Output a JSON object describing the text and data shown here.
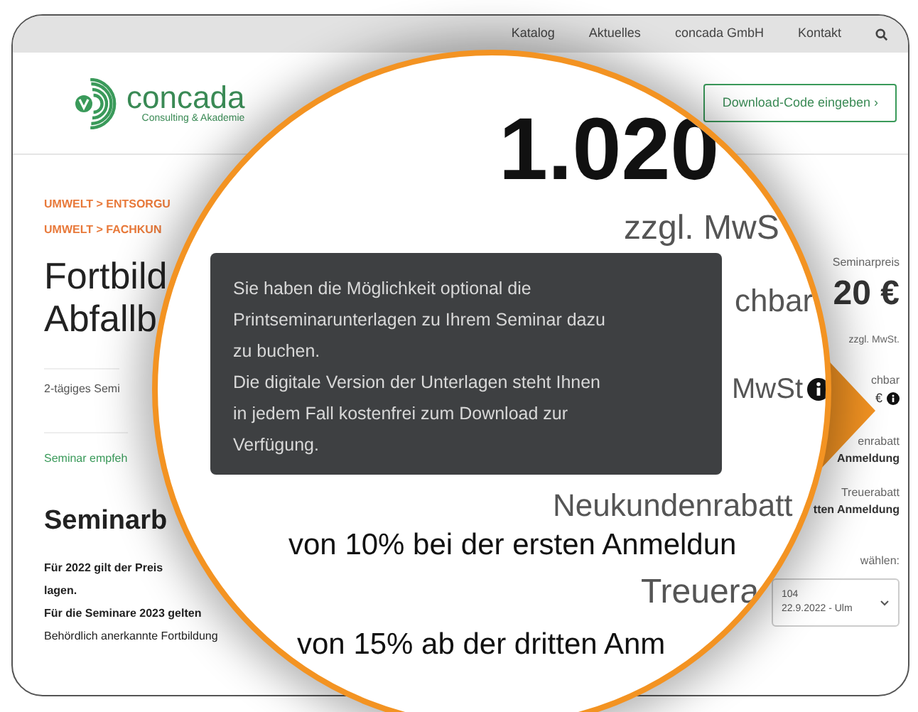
{
  "top_nav": {
    "links": [
      "Katalog",
      "Aktuelles",
      "concada GmbH",
      "Kontakt"
    ]
  },
  "header": {
    "logo_name": "concada",
    "logo_tagline": "Consulting & Akademie",
    "download_button": "Download-Code eingeben ›"
  },
  "main": {
    "breadcrumbs": [
      "UMWELT > ENTSORGU",
      "UMWELT > FACHKUN"
    ],
    "title_lines": [
      "Fortbild",
      "Abfallb"
    ],
    "subtitle": "2-tägiges Semi",
    "recommend": "Seminar empfeh",
    "section_title": "Seminarb",
    "paragraphs": [
      "Für 2022 gilt der Preis",
      "lagen.",
      "Für die Seminare 2023 gelten",
      "Behördlich anerkannte Fortbildung"
    ]
  },
  "sidebar": {
    "price_label": "Seminarpreis",
    "price": "20 €",
    "price_tax": "zzgl. MwSt.",
    "print_label": "chbar",
    "print_price": "€",
    "new_customer_label": "enrabatt",
    "new_customer_text": "Anmeldung",
    "loyalty_label": "Treuerabatt",
    "loyalty_text": "tten Anmeldung",
    "date_label": "wählen:",
    "date_select": {
      "line_1": "104",
      "line_2": "22.9.2022 - Ulm"
    }
  },
  "magnifier": {
    "price": "1.020",
    "tax": "zzgl. MwS",
    "print_label": "chbar",
    "print_tax": "MwSt",
    "new_customer_label": "Neukundenrabatt",
    "new_customer_text": "von 10% bei der ersten Anmeldun",
    "loyalty_label": "Treuera",
    "loyalty_text": "von 15% ab der dritten Anm"
  },
  "tooltip": {
    "lines": [
      "Sie haben die Möglichkeit optional die",
      "Printseminarunterlagen zu Ihrem Seminar dazu",
      "zu buchen.",
      "Die digitale Version der Unterlagen steht Ihnen",
      "in jedem Fall kostenfrei zum Download zur",
      "Verfügung."
    ]
  }
}
